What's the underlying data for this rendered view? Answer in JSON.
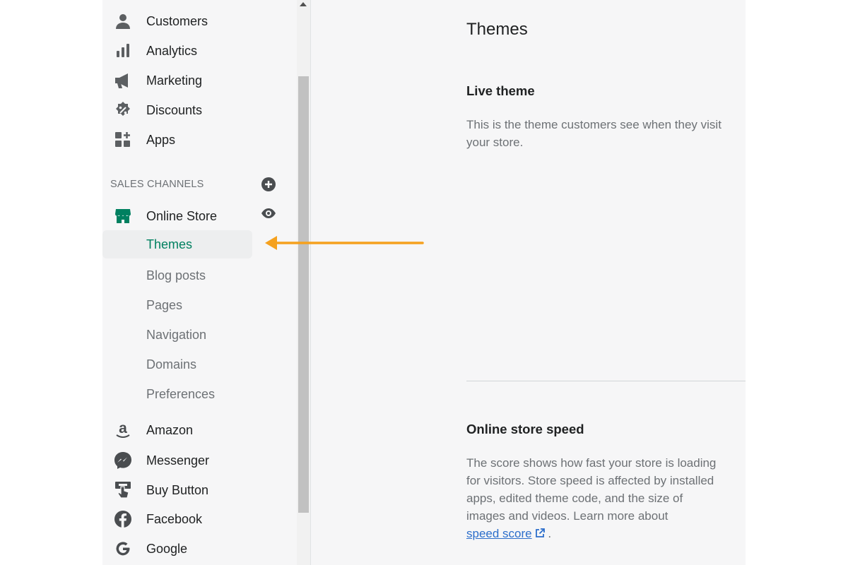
{
  "sidebar": {
    "main_items": [
      {
        "label": "Customers",
        "icon": "person-icon"
      },
      {
        "label": "Analytics",
        "icon": "bar-chart-icon"
      },
      {
        "label": "Marketing",
        "icon": "megaphone-icon"
      },
      {
        "label": "Discounts",
        "icon": "discount-badge-icon"
      },
      {
        "label": "Apps",
        "icon": "apps-grid-icon"
      }
    ],
    "sales_channels_heading": "SALES CHANNELS",
    "online_store": {
      "label": "Online Store",
      "icon": "storefront-icon"
    },
    "online_store_sub": [
      {
        "label": "Themes",
        "active": true
      },
      {
        "label": "Blog posts"
      },
      {
        "label": "Pages"
      },
      {
        "label": "Navigation"
      },
      {
        "label": "Domains"
      },
      {
        "label": "Preferences"
      }
    ],
    "channels": [
      {
        "label": "Amazon",
        "icon": "amazon-icon"
      },
      {
        "label": "Messenger",
        "icon": "messenger-icon"
      },
      {
        "label": "Buy Button",
        "icon": "buy-button-icon"
      },
      {
        "label": "Facebook",
        "icon": "facebook-icon"
      },
      {
        "label": "Google",
        "icon": "google-icon"
      }
    ]
  },
  "main": {
    "title": "Themes",
    "live_theme": {
      "title": "Live theme",
      "description": "This is the theme customers see when they visit your store."
    },
    "speed": {
      "title": "Online store speed",
      "description": "The score shows how fast your store is loading for visitors. Store speed is affected by installed apps, edited theme code, and the size of images and videos. Learn more about",
      "link_text": "speed score",
      "trailing": "."
    }
  },
  "colors": {
    "accent": "#008060",
    "annotation_arrow": "#f5a11e",
    "link": "#2c6ecb"
  }
}
